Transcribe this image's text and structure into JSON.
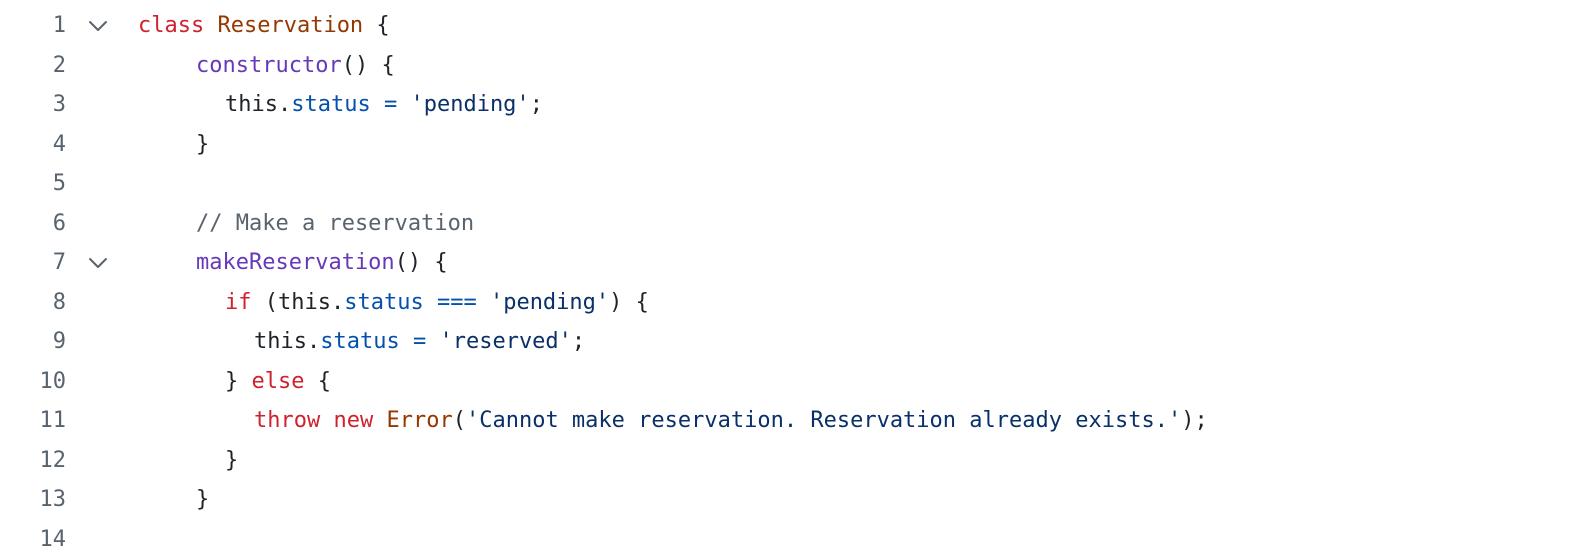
{
  "colors": {
    "keyword": "#cf222e",
    "class_name": "#953800",
    "function": "#6639ba",
    "property": "#0550ae",
    "string": "#0a3069",
    "comment": "#59636e",
    "text": "#1f2328",
    "line_number": "#59636e"
  },
  "icons": {
    "fold": "chevron-down-icon"
  },
  "lines": [
    {
      "number": "1",
      "fold": true,
      "indent": 0,
      "tokens": [
        {
          "t": "kw",
          "v": "class"
        },
        {
          "t": "txt",
          "v": " "
        },
        {
          "t": "cls",
          "v": "Reservation"
        },
        {
          "t": "txt",
          "v": " {"
        }
      ]
    },
    {
      "number": "2",
      "fold": false,
      "indent": 4,
      "tokens": [
        {
          "t": "fn",
          "v": "constructor"
        },
        {
          "t": "txt",
          "v": "() {"
        }
      ]
    },
    {
      "number": "3",
      "fold": false,
      "indent": 6,
      "tokens": [
        {
          "t": "txt",
          "v": "this."
        },
        {
          "t": "prop",
          "v": "status"
        },
        {
          "t": "txt",
          "v": " "
        },
        {
          "t": "op",
          "v": "="
        },
        {
          "t": "txt",
          "v": " "
        },
        {
          "t": "str",
          "v": "'pending'"
        },
        {
          "t": "txt",
          "v": ";"
        }
      ]
    },
    {
      "number": "4",
      "fold": false,
      "indent": 4,
      "tokens": [
        {
          "t": "txt",
          "v": "}"
        }
      ]
    },
    {
      "number": "5",
      "fold": false,
      "indent": 0,
      "tokens": []
    },
    {
      "number": "6",
      "fold": false,
      "indent": 4,
      "tokens": [
        {
          "t": "cm",
          "v": "// Make a reservation"
        }
      ]
    },
    {
      "number": "7",
      "fold": true,
      "indent": 4,
      "tokens": [
        {
          "t": "fn",
          "v": "makeReservation"
        },
        {
          "t": "txt",
          "v": "() {"
        }
      ]
    },
    {
      "number": "8",
      "fold": false,
      "indent": 6,
      "tokens": [
        {
          "t": "kw",
          "v": "if"
        },
        {
          "t": "txt",
          "v": " (this."
        },
        {
          "t": "prop",
          "v": "status"
        },
        {
          "t": "txt",
          "v": " "
        },
        {
          "t": "op",
          "v": "==="
        },
        {
          "t": "txt",
          "v": " "
        },
        {
          "t": "str",
          "v": "'pending'"
        },
        {
          "t": "txt",
          "v": ") {"
        }
      ]
    },
    {
      "number": "9",
      "fold": false,
      "indent": 8,
      "tokens": [
        {
          "t": "txt",
          "v": "this."
        },
        {
          "t": "prop",
          "v": "status"
        },
        {
          "t": "txt",
          "v": " "
        },
        {
          "t": "op",
          "v": "="
        },
        {
          "t": "txt",
          "v": " "
        },
        {
          "t": "str",
          "v": "'reserved'"
        },
        {
          "t": "txt",
          "v": ";"
        }
      ]
    },
    {
      "number": "10",
      "fold": false,
      "indent": 6,
      "tokens": [
        {
          "t": "txt",
          "v": "} "
        },
        {
          "t": "kw",
          "v": "else"
        },
        {
          "t": "txt",
          "v": " {"
        }
      ]
    },
    {
      "number": "11",
      "fold": false,
      "indent": 8,
      "tokens": [
        {
          "t": "kw",
          "v": "throw"
        },
        {
          "t": "txt",
          "v": " "
        },
        {
          "t": "kw",
          "v": "new"
        },
        {
          "t": "txt",
          "v": " "
        },
        {
          "t": "cls",
          "v": "Error"
        },
        {
          "t": "txt",
          "v": "("
        },
        {
          "t": "str",
          "v": "'Cannot make reservation. Reservation already exists.'"
        },
        {
          "t": "txt",
          "v": ");"
        }
      ]
    },
    {
      "number": "12",
      "fold": false,
      "indent": 6,
      "tokens": [
        {
          "t": "txt",
          "v": "}"
        }
      ]
    },
    {
      "number": "13",
      "fold": false,
      "indent": 4,
      "tokens": [
        {
          "t": "txt",
          "v": "}"
        }
      ]
    },
    {
      "number": "14",
      "fold": false,
      "indent": 0,
      "tokens": []
    }
  ]
}
